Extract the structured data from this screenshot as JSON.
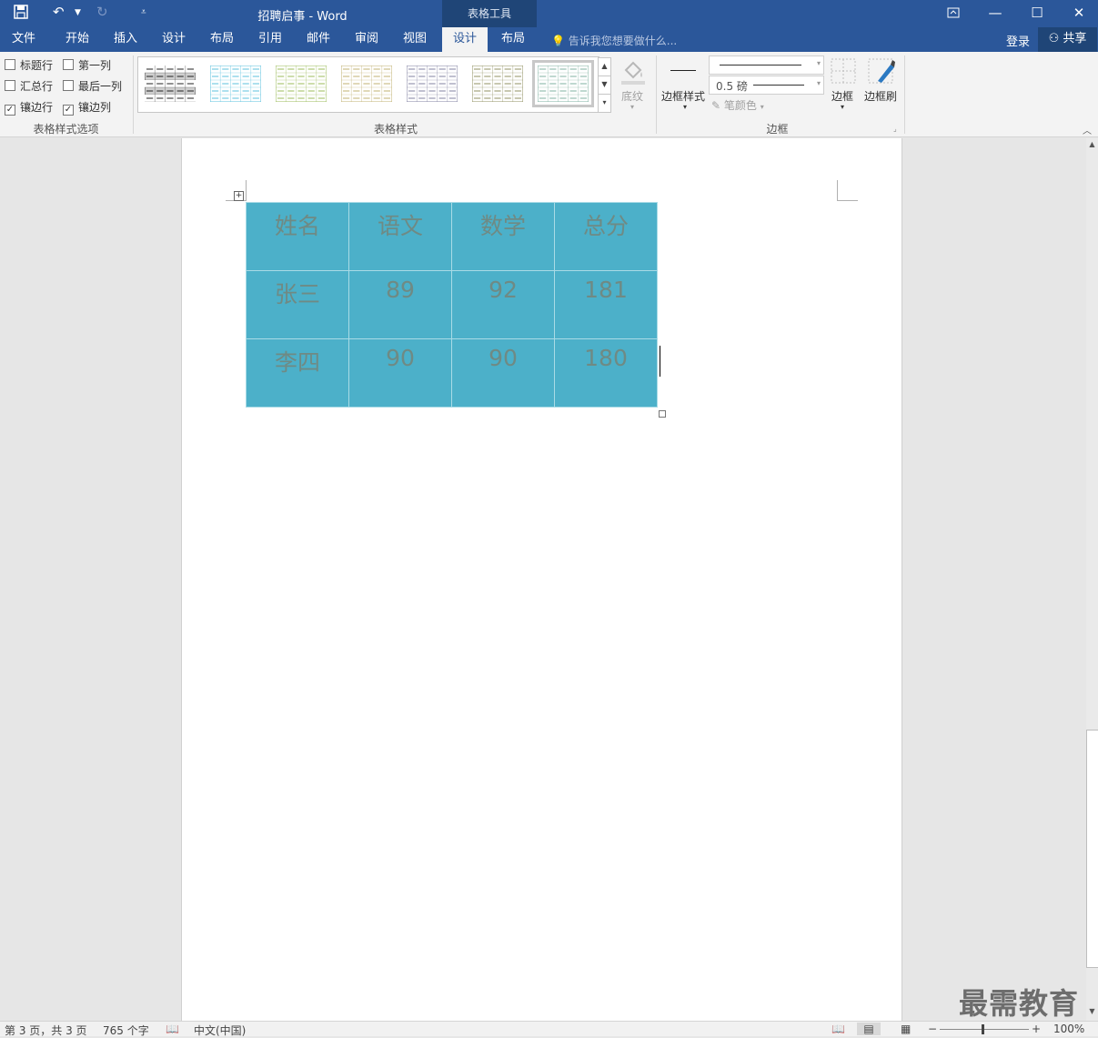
{
  "titlebar": {
    "title": "招聘启事 - Word",
    "context_group": "表格工具",
    "qat": {
      "save_icon": "save-icon",
      "undo_icon": "undo-icon",
      "redo_icon": "redo-icon",
      "customize_icon": "customize-qat-icon"
    },
    "window_buttons": {
      "restore_ribbon_icon": "ribbon-display-icon",
      "minimize": "—",
      "maximize": "☐",
      "close": "✕"
    }
  },
  "tabs": [
    {
      "label": "文件"
    },
    {
      "label": "开始"
    },
    {
      "label": "插入"
    },
    {
      "label": "设计"
    },
    {
      "label": "布局"
    },
    {
      "label": "引用"
    },
    {
      "label": "邮件"
    },
    {
      "label": "审阅"
    },
    {
      "label": "视图"
    },
    {
      "label": "设计",
      "active": true
    },
    {
      "label": "布局"
    }
  ],
  "tell_me": "告诉我您想要做什么...",
  "login": "登录",
  "share": "共享",
  "ribbon": {
    "options": {
      "header_row": {
        "label": "标题行",
        "checked": false
      },
      "total_row": {
        "label": "汇总行",
        "checked": false
      },
      "banded_rows": {
        "label": "镶边行",
        "checked": true
      },
      "first_column": {
        "label": "第一列",
        "checked": false
      },
      "last_column": {
        "label": "最后一列",
        "checked": false
      },
      "banded_columns": {
        "label": "镶边列",
        "checked": true
      },
      "group_label": "表格样式选项"
    },
    "styles": {
      "group_label": "表格样式",
      "thumb_colors": [
        "#4a4a4a",
        "#5bc0de",
        "#9bbb59",
        "#c0b070",
        "#8080a0",
        "#909060",
        "#7fb0a0"
      ]
    },
    "shading_label": "底纹",
    "border_styles_label": "边框样式",
    "pen_weight": "0.5 磅",
    "pen_color_label": "笔颜色",
    "borders_label": "边框",
    "border_painter_label": "边框刷",
    "border_group_label": "边框"
  },
  "table": {
    "rows": [
      [
        "姓名",
        "语文",
        "数学",
        "总分"
      ],
      [
        "张三",
        "89",
        "92",
        "181"
      ],
      [
        "李四",
        "90",
        "90",
        "180"
      ]
    ],
    "fill_color": "#4cb0c9"
  },
  "status": {
    "page": "第 3 页，共 3 页",
    "words": "765 个字",
    "language": "中文(中国)",
    "zoom": "100%"
  },
  "watermark": "最需教育"
}
